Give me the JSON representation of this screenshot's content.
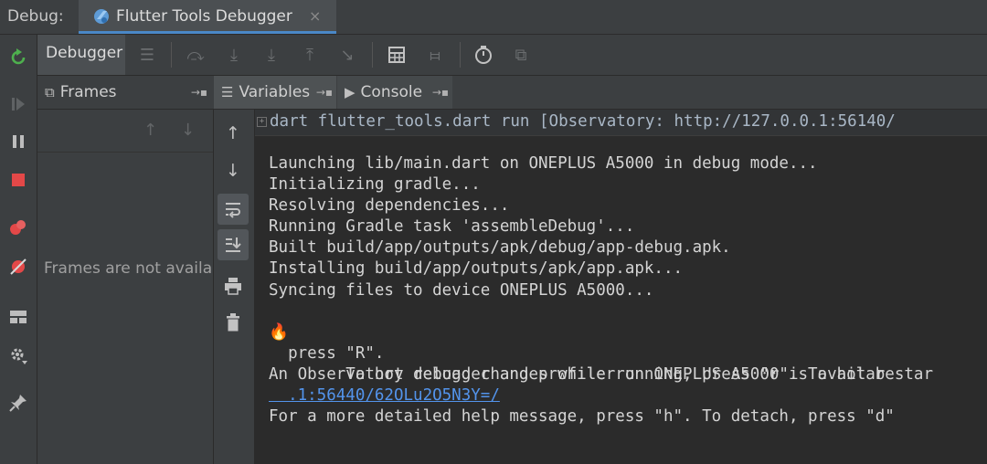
{
  "topbar": {
    "label": "Debug:",
    "tab_title": "Flutter Tools Debugger",
    "close_glyph": "×"
  },
  "toolbar": {
    "debugger_label": "Debugger"
  },
  "subtabs": [
    {
      "label": "Frames"
    },
    {
      "label": "Variables"
    },
    {
      "label": "Console"
    }
  ],
  "frames": {
    "empty_text": "Frames are not available"
  },
  "console": {
    "command": "dart flutter_tools.dart run [Observatory: http://127.0.0.1:56140/",
    "lines": [
      "Launching lib/main.dart on ONEPLUS A5000 in debug mode...",
      "Initializing gradle...",
      "Resolving dependencies...",
      "Running Gradle task 'assembleDebug'...",
      "Built build/app/outputs/apk/debug/app-debug.apk.",
      "Installing build/app/outputs/apk/app.apk...",
      "Syncing files to device ONEPLUS A5000...",
      "",
      "  To hot reload changes while running, press \"r\". To hot restar",
      "  press \"R\".",
      "An Observatory debugger and profiler on ONEPLUS A5000 is availab",
      "  .1:56440/62OLu2O5N3Y=/",
      "For a more detailed help message, press \"h\". To detach, press \"d\""
    ],
    "hot_reload_icon": "🔥"
  },
  "colors": {
    "accent": "#4a88c7",
    "link": "#5394ec",
    "rerun": "#4eb04e",
    "stop": "#e34848"
  }
}
